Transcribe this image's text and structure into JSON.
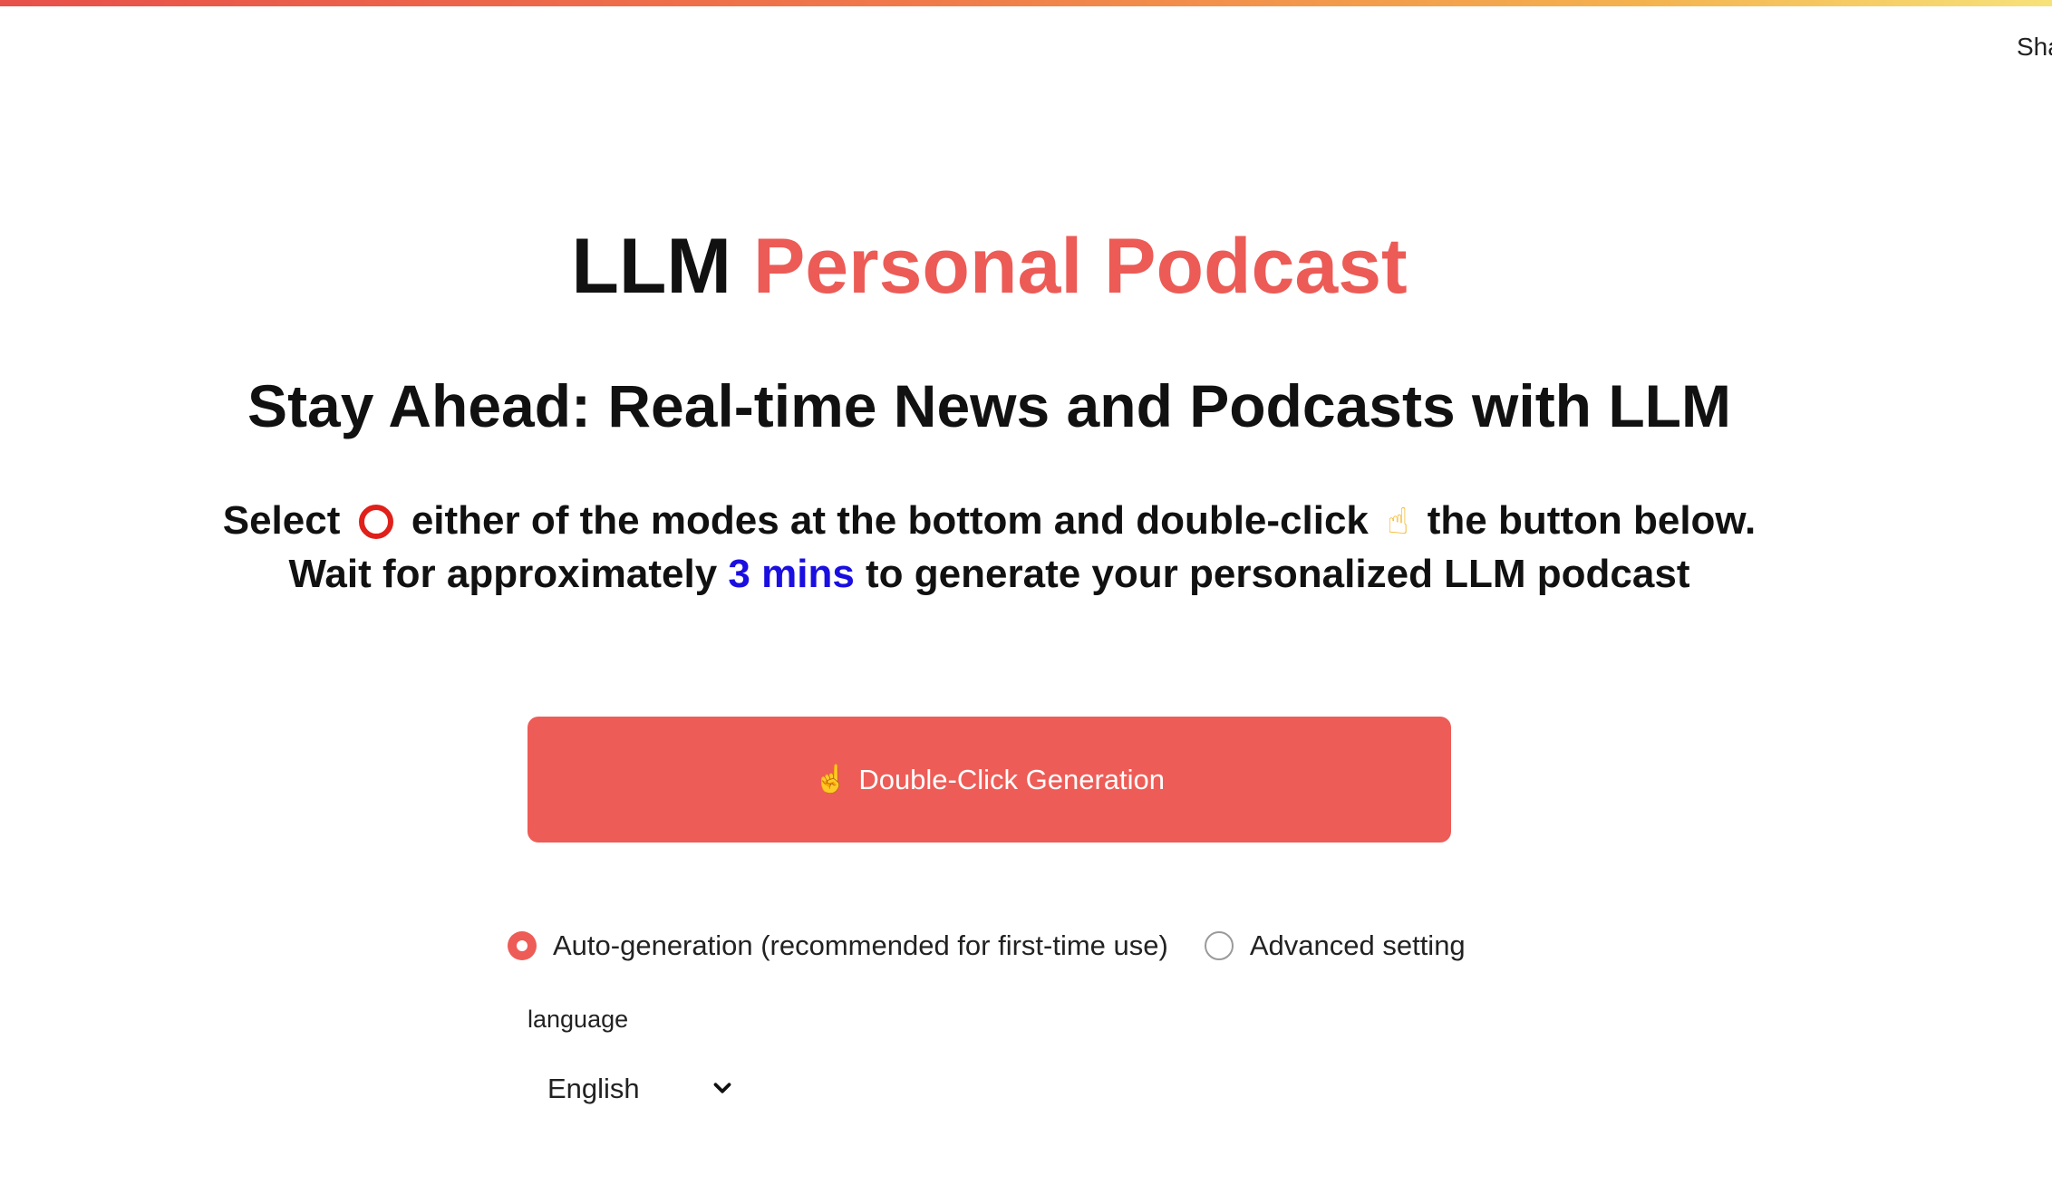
{
  "header": {
    "share_label": "Sha"
  },
  "hero": {
    "title_part1": "LLM ",
    "title_part2": "Personal Podcast",
    "subtitle": "Stay Ahead: Real-time News and Podcasts with LLM",
    "line1_select": "Select ",
    "line1_middle": " either of the modes at the bottom and double-click ",
    "line1_end": " the button below.",
    "line2_start": "Wait for approximately ",
    "line2_highlight": "3 mins",
    "line2_end": " to generate your personalized LLM podcast"
  },
  "generate_button": {
    "icon_glyph": "☝",
    "label": "Double-Click Generation"
  },
  "mode_options": [
    {
      "label": "Auto-generation (recommended for first-time use)",
      "selected": true
    },
    {
      "label": "Advanced setting",
      "selected": false
    }
  ],
  "language": {
    "label": "language",
    "selected": "English"
  },
  "icons": {
    "ring": "heavy-large-circle-icon",
    "hand": "pointing-hand-icon",
    "chevron": "chevron-down-icon"
  },
  "colors": {
    "accent": "#ec5b56",
    "highlight": "#1a0fe0",
    "button": "#ee5c57",
    "ring": "#e0201b"
  }
}
